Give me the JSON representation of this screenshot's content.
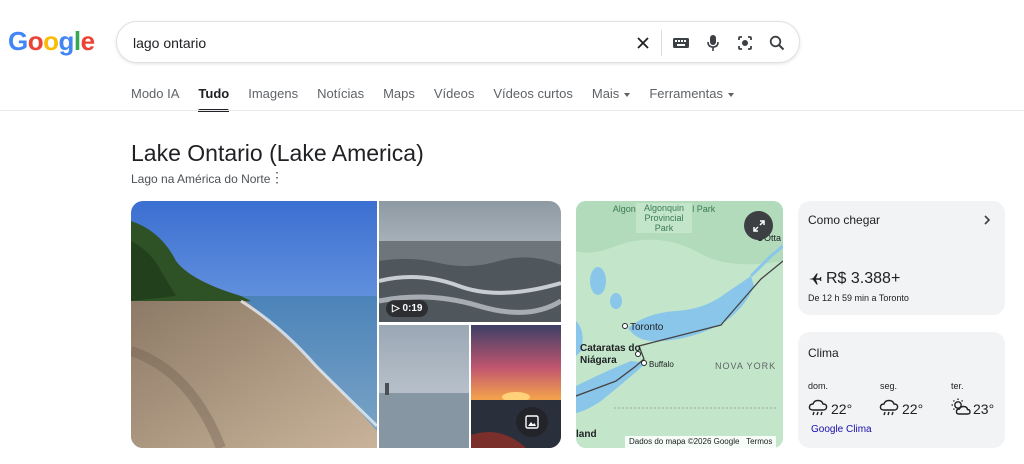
{
  "header": {
    "logo_letters": [
      "G",
      "o",
      "o",
      "g",
      "l",
      "e"
    ],
    "logo_colors": [
      "#4285f4",
      "#ea4335",
      "#fbbc05",
      "#4285f4",
      "#34a853",
      "#ea4335"
    ],
    "search_value": "lago ontario"
  },
  "tabs": [
    {
      "label": "Modo IA"
    },
    {
      "label": "Tudo"
    },
    {
      "label": "Imagens"
    },
    {
      "label": "Notícias"
    },
    {
      "label": "Maps"
    },
    {
      "label": "Vídeos"
    },
    {
      "label": "Vídeos curtos"
    },
    {
      "label": "Mais"
    },
    {
      "label": "Ferramentas"
    }
  ],
  "active_tab": "Tudo",
  "panel": {
    "title": "Lake Ontario (Lake America)",
    "subtitle": "Lago na América do Norte",
    "video_duration": "0:19"
  },
  "map": {
    "labels": {
      "park": "Algonquin Provincial Park",
      "toronto": "Toronto",
      "cataratas": "Cataratas do Niágara",
      "buffalo": "Buffalo",
      "ny": "NOVA YORK",
      "ottawa": "Otta",
      "land": "land"
    },
    "footer_data": "Dados do mapa ©2026 Google",
    "footer_terms": "Termos"
  },
  "directions": {
    "title": "Como chegar",
    "price": "R$ 3.388+",
    "detail": "De 12 h 59 min a Toronto"
  },
  "weather": {
    "title": "Clima",
    "days": [
      {
        "day": "dom.",
        "temp": "22°",
        "icon": "rain-cloud-icon"
      },
      {
        "day": "seg.",
        "temp": "22°",
        "icon": "rain-cloud-icon"
      },
      {
        "day": "ter.",
        "temp": "23°",
        "icon": "partly-sunny-icon"
      }
    ],
    "link": "Google Clima"
  }
}
